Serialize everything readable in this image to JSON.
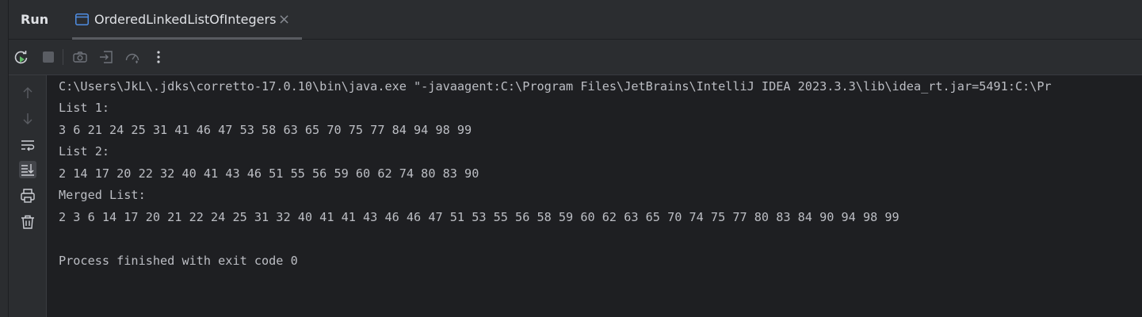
{
  "header": {
    "title": "Run",
    "tab": {
      "label": "OrderedLinkedListOfIntegers"
    }
  },
  "toolbar": {
    "buttons": [
      "rerun-icon",
      "stop-icon",
      "camera-icon",
      "exit-icon",
      "profiler-icon",
      "more-icon"
    ]
  },
  "sidebar": {
    "buttons": [
      "arrow-up-icon",
      "arrow-down-icon",
      "soft-wrap-icon",
      "scroll-to-end-icon",
      "print-icon",
      "trash-icon"
    ]
  },
  "console": {
    "lines": [
      "C:\\Users\\JkL\\.jdks\\corretto-17.0.10\\bin\\java.exe \"-javaagent:C:\\Program Files\\JetBrains\\IntelliJ IDEA 2023.3.3\\lib\\idea_rt.jar=5491:C:\\Pr",
      "List 1:",
      "3 6 21 24 25 31 41 46 47 53 58 63 65 70 75 77 84 94 98 99",
      "List 2:",
      "2 14 17 20 22 32 40 41 43 46 51 55 56 59 60 62 74 80 83 90",
      "Merged List:",
      "2 3 6 14 17 20 21 22 24 25 31 32 40 41 41 43 46 46 47 51 53 55 56 58 59 60 62 63 65 70 74 75 77 80 83 84 90 94 98 99",
      "",
      "Process finished with exit code 0"
    ]
  }
}
